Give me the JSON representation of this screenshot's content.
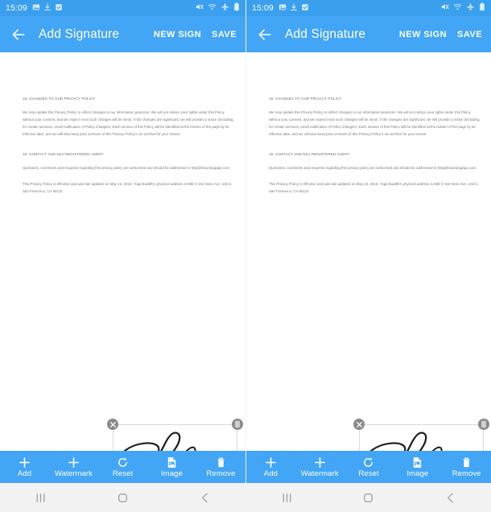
{
  "app": {
    "statusbar": {
      "clock": "15:09",
      "left_icons": [
        "image-icon",
        "download-icon",
        "checkbox-icon"
      ],
      "right_icons": [
        "mute-icon",
        "wifi-icon",
        "airplane-mode-icon",
        "battery-icon"
      ],
      "background": "#3AA0EE"
    },
    "appbar": {
      "back_label": "back-arrow",
      "title": "Add Signature",
      "new_sign_label": "NEW SIGN",
      "save_label": "SAVE",
      "background": "#42A5F5"
    },
    "document": {
      "section_18_heading": "18. CHANGES TO OUR PRIVACY POLICY",
      "section_18_body": "We may update this Privacy Policy to reflect changes to our information practices. We will not reduce your rights under this Policy without your consent, and we expect most such changes will be minor. If the changes are significant, we will provide a notice (including, for certain services, email notification of Policy changes). Each version of this Policy will be identified at the bottom of the page by its effective date, and we will also keep prior versions of this Privacy Policy in an archive for your review.",
      "section_19_heading": "19. CONTACT AND EEA REGISTERED AGENT",
      "section_19_body": "Questions, comments and requests regarding this privacy policy are welcomed and should be addressed to help@downdogapp.com.",
      "section_19_body2": "This Privacy Policy is effective and was last updated on May 24, 2018. Yoga Buddhi's physical address is 588 S Van Ness Ave, Unit 6, San Francisco, CA 94110."
    },
    "signature": {
      "name": "signature-object",
      "close_icon": "close-icon",
      "grip_icon": "grip-handle-icon",
      "resize_icon": "rotate-resize-icon"
    },
    "toolbar": {
      "items": [
        {
          "label": "Add",
          "icon": "plus-icon"
        },
        {
          "label": "Watermark",
          "icon": "plus-icon"
        },
        {
          "label": "Reset",
          "icon": "refresh-icon"
        },
        {
          "label": "Image",
          "icon": "image-icon"
        },
        {
          "label": "Remove",
          "icon": "trash-icon"
        }
      ],
      "background": "#42A5F5"
    },
    "navbar": {
      "recents_label": "recents-icon",
      "home_label": "home-icon",
      "back_label": "back-icon",
      "background": "#f2f2f2"
    }
  },
  "colors": {
    "accent": "#42A5F5",
    "statusbar": "#3AA0EE",
    "page": "#ffffff",
    "doc_text": "#7a7a7a",
    "handle": "#8a8a8a"
  }
}
